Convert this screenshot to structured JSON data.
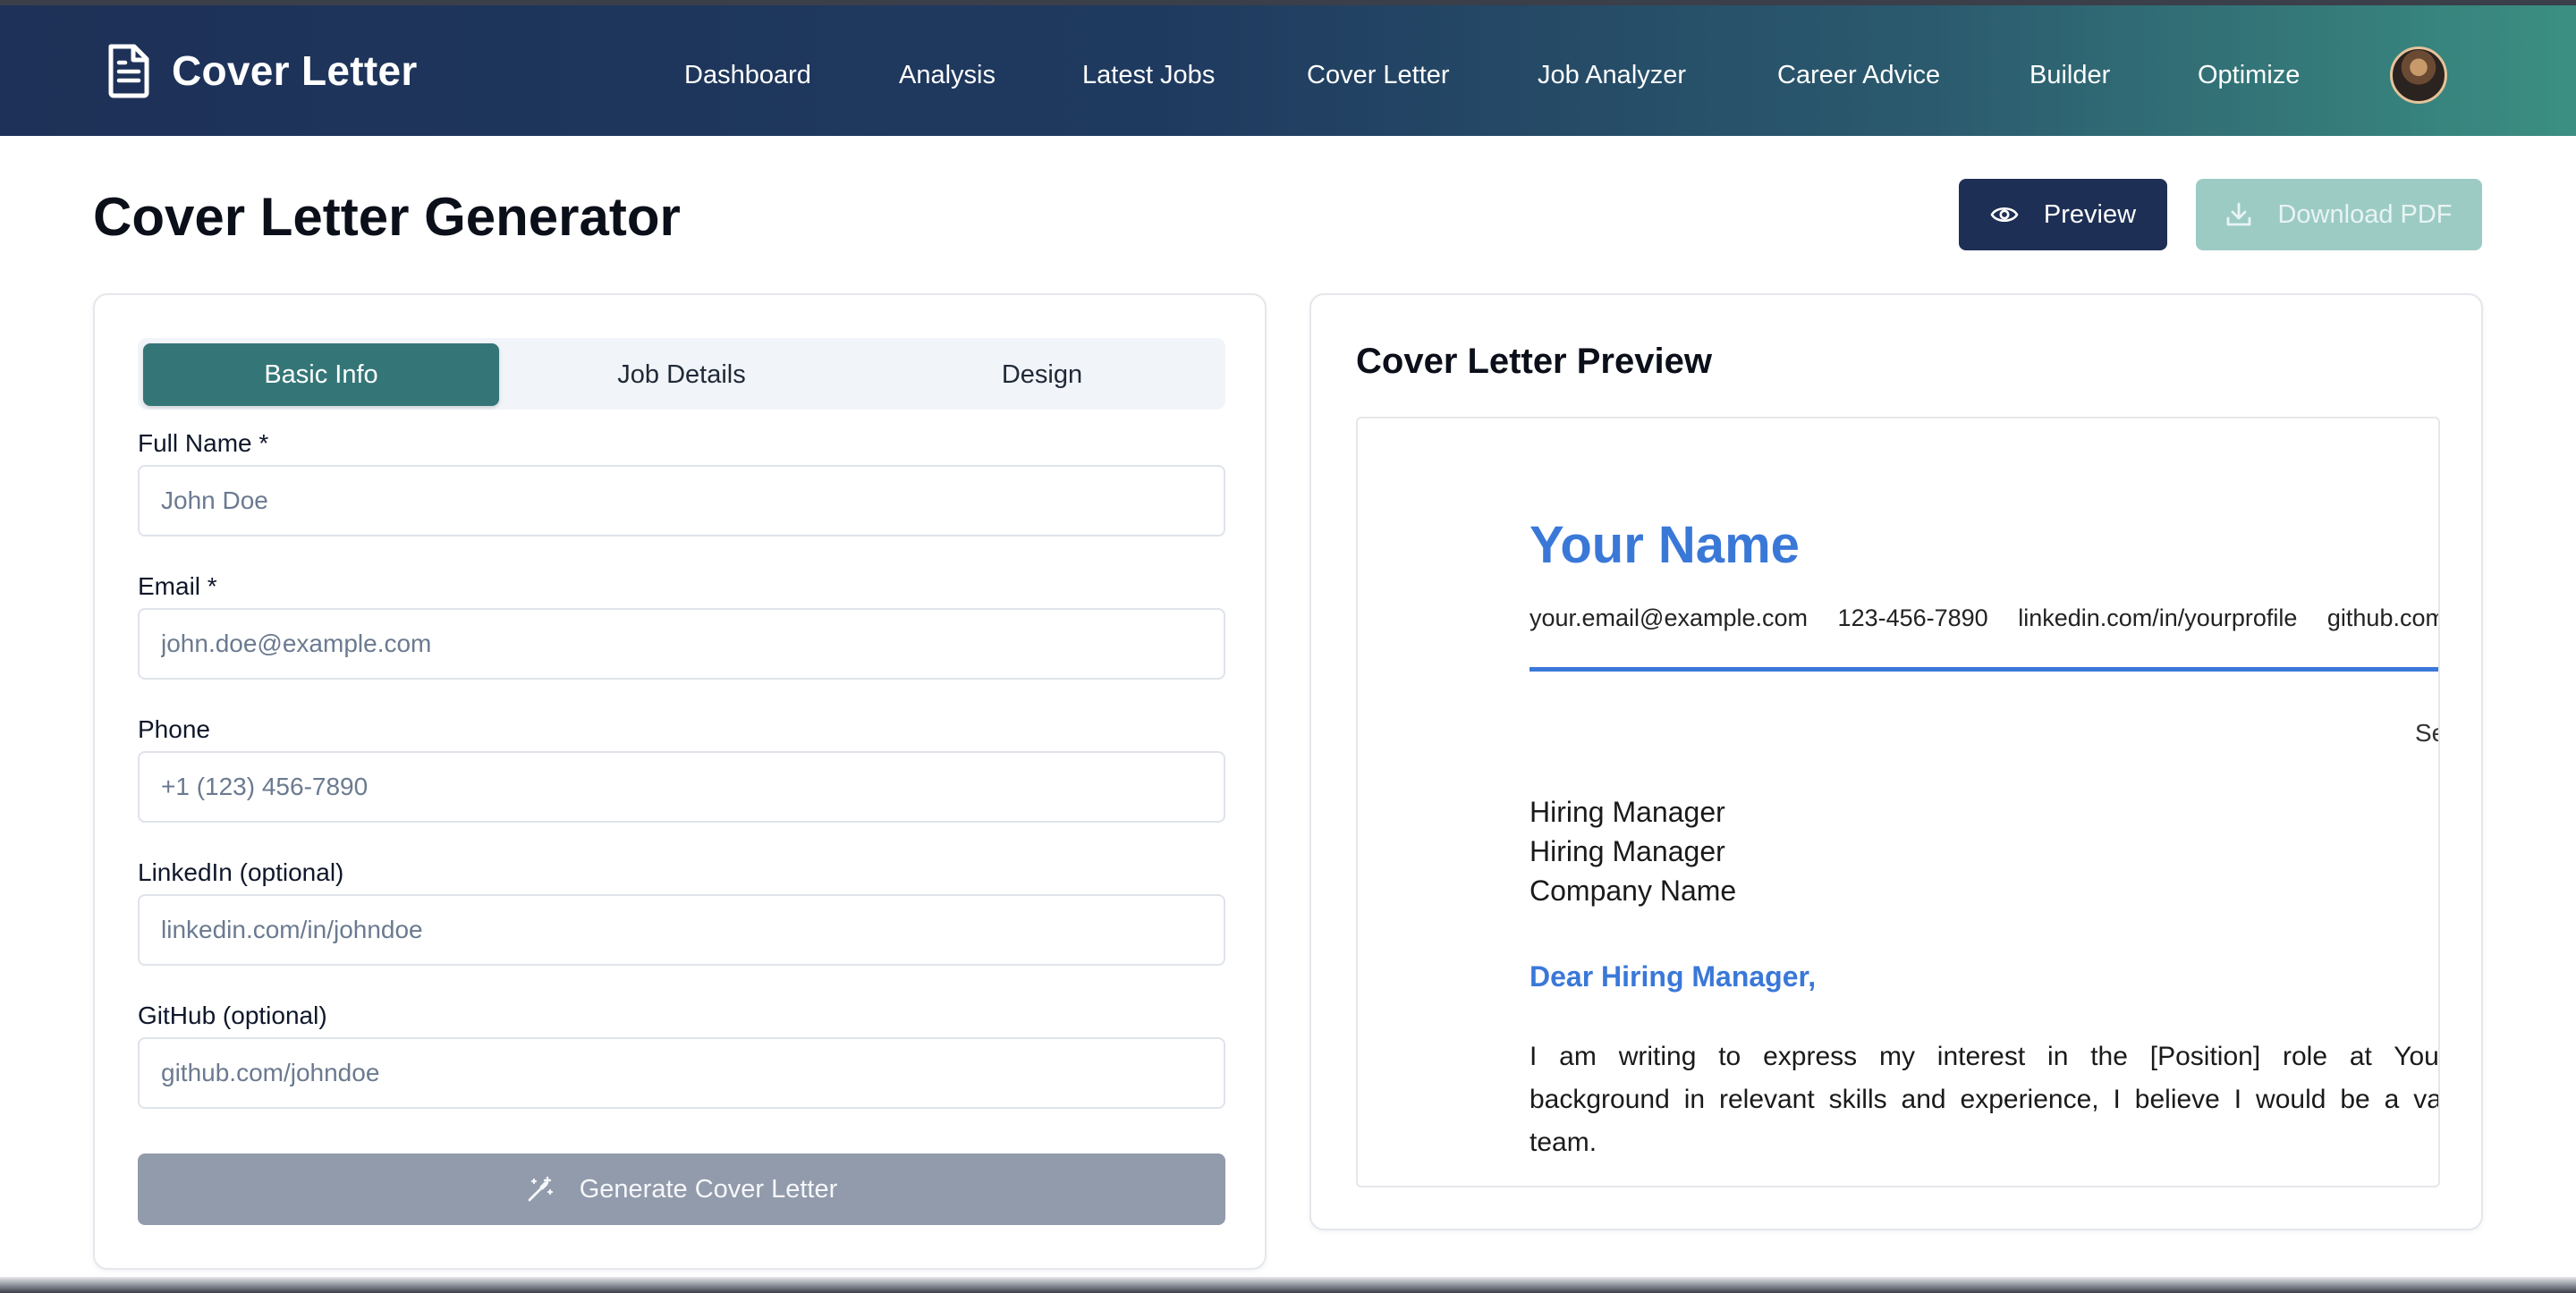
{
  "app": {
    "brand": "Cover Letter",
    "nav": [
      "Dashboard",
      "Analysis",
      "Latest Jobs",
      "Cover Letter",
      "Job Analyzer",
      "Career Advice",
      "Builder",
      "Optimize"
    ],
    "avatar": "user-avatar"
  },
  "page": {
    "title": "Cover Letter Generator",
    "preview_label": "Preview",
    "download_label": "Download PDF"
  },
  "form": {
    "tabs": [
      "Basic Info",
      "Job Details",
      "Design"
    ],
    "active_tab": "Basic Info",
    "fields": [
      {
        "label": "Full Name *",
        "placeholder": "John Doe",
        "value": ""
      },
      {
        "label": "Email *",
        "placeholder": "john.doe@example.com",
        "value": ""
      },
      {
        "label": "Phone",
        "placeholder": "+1 (123) 456-7890",
        "value": ""
      },
      {
        "label": "LinkedIn (optional)",
        "placeholder": "linkedin.com/in/johndoe",
        "value": ""
      },
      {
        "label": "GitHub (optional)",
        "placeholder": "github.com/johndoe",
        "value": ""
      }
    ],
    "generate_label": "Generate Cover Letter"
  },
  "preview": {
    "title": "Cover Letter Preview",
    "name": "Your Name",
    "contacts": [
      "your.email@example.com",
      "123-456-7890",
      "linkedin.com/in/yourprofile",
      "github.com/"
    ],
    "date": "Se",
    "recipient": [
      "Hiring Manager",
      "Hiring Manager",
      "Company Name"
    ],
    "greeting": "Dear Hiring Manager,",
    "body": "I am writing to express my interest in the [Position] role at Your Cor background in relevant skills and experience, I believe I would be a valuable team."
  },
  "colors": {
    "nav_start": "#1e3158",
    "nav_end": "#3b8f82",
    "accent_teal": "#347678",
    "preview_button": "#1e2f55",
    "download_button_disabled": "#9ccbc4",
    "generate_button_disabled": "#929bab",
    "letter_accent": "#3a78d8"
  },
  "icons": {
    "brand": "document-icon",
    "preview": "eye-icon",
    "download": "download-icon",
    "generate": "magic-wand-icon"
  }
}
